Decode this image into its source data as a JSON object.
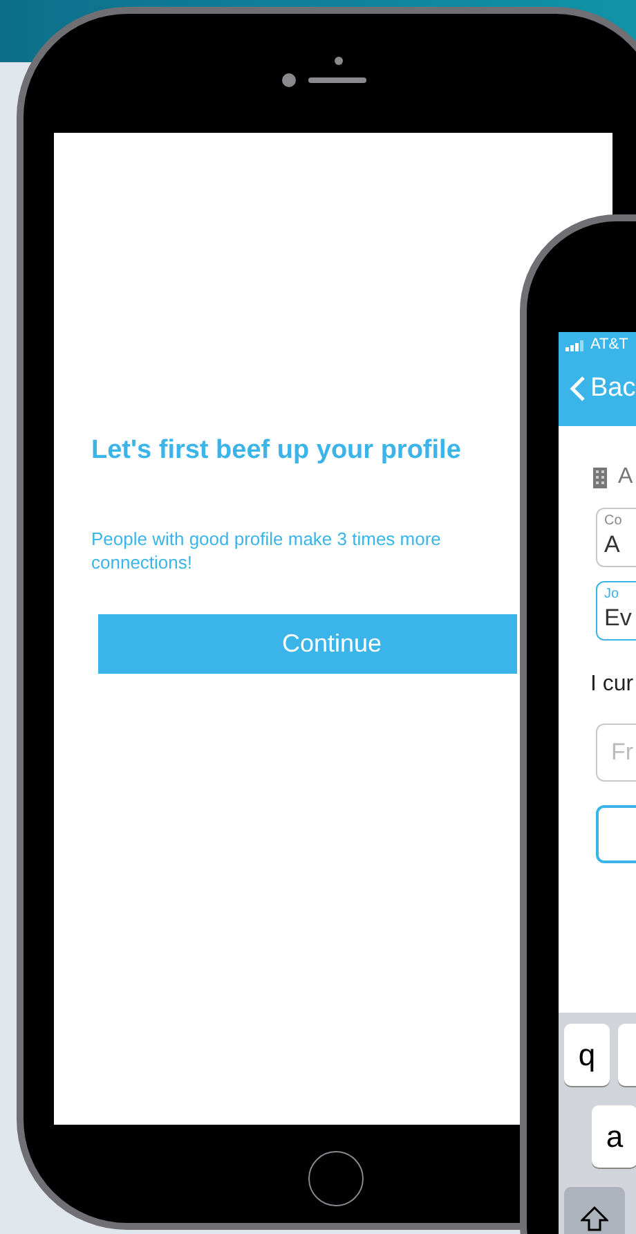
{
  "left_phone": {
    "heading": "Let's first beef up your profile",
    "subtitle": "People with good profile make 3 times more connections!",
    "button": "Continue"
  },
  "right_phone": {
    "status_bar": {
      "carrier": "AT&T"
    },
    "nav": {
      "back": "Bac"
    },
    "company_row": {
      "text": "A"
    },
    "fields": [
      {
        "label": "Co",
        "value": "A",
        "focused": false
      },
      {
        "label": "Jo",
        "value": "Ev",
        "focused": true
      }
    ],
    "prompt": "I cur",
    "input": {
      "placeholder": "Fr"
    },
    "keyboard": {
      "rows": [
        [
          "q"
        ],
        [
          "a"
        ]
      ]
    }
  }
}
